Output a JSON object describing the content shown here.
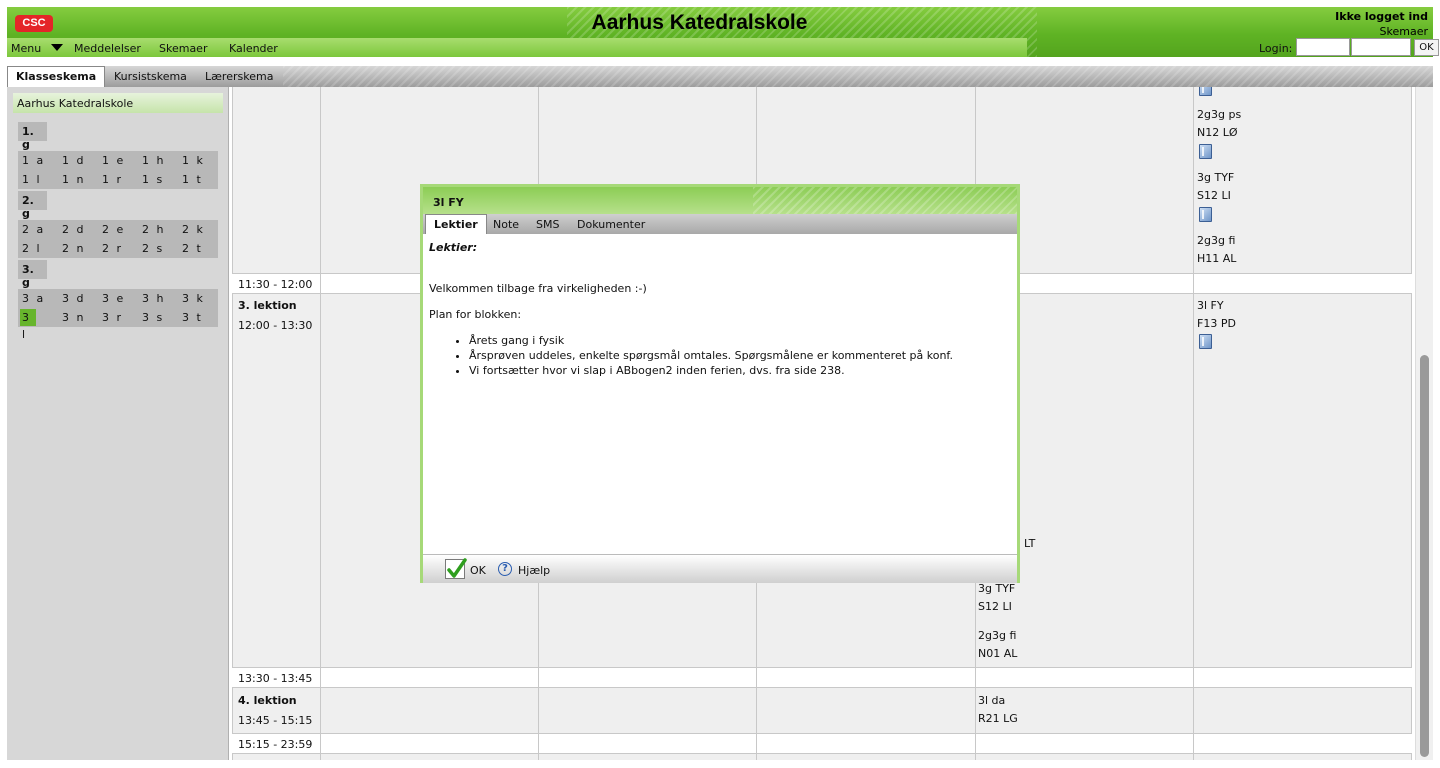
{
  "header": {
    "logo": "CSC",
    "title": "Aarhus Katedralskole",
    "login_status": "Ikke logget ind",
    "skemaer_link": "Skemaer",
    "login_label": "Login:",
    "ok_button": "OK"
  },
  "nav": {
    "menu": "Menu",
    "items": [
      "Meddelelser",
      "Skemaer",
      "Kalender"
    ]
  },
  "tabs": [
    "Klasseskema",
    "Kursistskema",
    "Lærerskema"
  ],
  "sidebar": {
    "school": "Aarhus Katedralskole",
    "grades": [
      {
        "label": "1. g",
        "classes": [
          "1 a",
          "1 d",
          "1 e",
          "1 h",
          "1 k",
          "1 l",
          "1 n",
          "1 r",
          "1 s",
          "1 t"
        ]
      },
      {
        "label": "2. g",
        "classes": [
          "2 a",
          "2 d",
          "2 e",
          "2 h",
          "2 k",
          "2 l",
          "2 n",
          "2 r",
          "2 s",
          "2 t"
        ]
      },
      {
        "label": "3. g",
        "classes": [
          "3 a",
          "3 d",
          "3 e",
          "3 h",
          "3 k",
          "3 l",
          "3 n",
          "3 r",
          "3 s",
          "3 t"
        ]
      }
    ],
    "selected": "3 l"
  },
  "schedule": {
    "t1": "11:30 - 12:00",
    "lesson3": "3. lektion",
    "t2": "12:00 - 13:30",
    "t3": "13:30 - 13:45",
    "lesson4": "4. lektion",
    "t4": "13:45 - 15:15",
    "t5": "15:15 - 23:59",
    "col5_top": [
      {
        "a": "2g3g ps",
        "b": "N12 LØ"
      },
      {
        "a": "3g TYF",
        "b": "S12 LI"
      },
      {
        "a": "2g3g fi",
        "b": "H11 AL"
      }
    ],
    "col5_lesson3": {
      "a": "3l FY",
      "b": "F13 PD"
    },
    "col4_partial": [
      "LT"
    ],
    "col4_entries": [
      {
        "a": "3g TYF",
        "b": "S12 LI"
      },
      {
        "a": "2g3g fi",
        "b": "N01 AL"
      }
    ],
    "col4_lesson4": {
      "a": "3l da",
      "b": "R21 LG"
    }
  },
  "dialog": {
    "title": "3l FY",
    "tabs": [
      "Lektier",
      "Note",
      "SMS",
      "Dokumenter"
    ],
    "heading": "Lektier:",
    "intro": "Velkommen tilbage fra virkeligheden :-)",
    "plan_label": "Plan for blokken:",
    "items": [
      "Årets gang i fysik",
      "Årsprøven uddeles, enkelte spørgsmål omtales. Spørgsmålene er kommenteret på konf.",
      "Vi fortsætter hvor vi slap i ABbogen2 inden ferien, dvs. fra side 238."
    ],
    "ok": "OK",
    "help": "Hjælp"
  }
}
